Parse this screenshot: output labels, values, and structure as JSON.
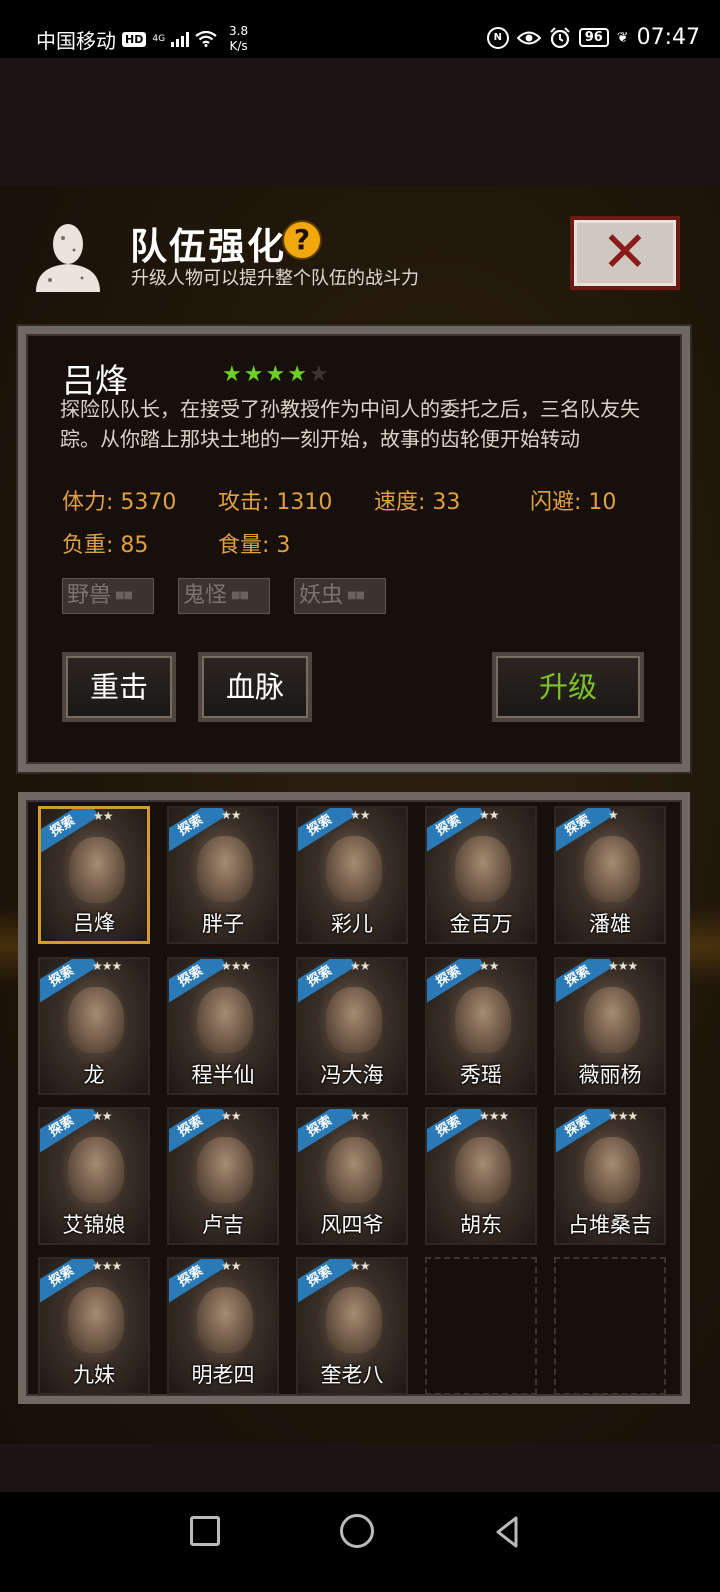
{
  "status_bar": {
    "carrier": "中国移动",
    "hd_badge": "HD",
    "network": "4G",
    "speed_value": "3.8",
    "speed_unit": "K/s",
    "battery": "96",
    "time": "07:47"
  },
  "header": {
    "title": "队伍强化",
    "help_icon": "?",
    "subtitle": "升级人物可以提升整个队伍的战斗力",
    "close_icon": "✕"
  },
  "hero": {
    "name": "吕烽",
    "stars_filled": 4,
    "stars_total": 5,
    "description": "探险队队长，在接受了孙教授作为中间人的委托之后，三名队友失踪。从你踏上那块土地的一刻开始，故事的齿轮便开始转动",
    "stats": {
      "hp": "体力: 5370",
      "attack": "攻击: 1310",
      "speed": "速度: 33",
      "dodge": "闪避: 10",
      "load": "负重: 85",
      "food": "食量: 3"
    },
    "tags": [
      "野兽",
      "鬼怪",
      "妖虫"
    ],
    "buttons": {
      "heavy_strike": "重击",
      "bloodline": "血脉",
      "upgrade": "升级"
    }
  },
  "roster": {
    "ribbon_label": "探索",
    "characters": [
      {
        "name": "吕烽",
        "stars": 2,
        "selected": true
      },
      {
        "name": "胖子",
        "stars": 2
      },
      {
        "name": "彩儿",
        "stars": 2
      },
      {
        "name": "金百万",
        "stars": 2
      },
      {
        "name": "潘雄",
        "stars": 1
      },
      {
        "name": "龙",
        "stars": 3
      },
      {
        "name": "程半仙",
        "stars": 3
      },
      {
        "name": "冯大海",
        "stars": 2
      },
      {
        "name": "秀瑶",
        "stars": 2
      },
      {
        "name": "薇丽杨",
        "stars": 3
      },
      {
        "name": "艾锦娘",
        "stars": 2
      },
      {
        "name": "卢吉",
        "stars": 2
      },
      {
        "name": "风四爷",
        "stars": 2
      },
      {
        "name": "胡东",
        "stars": 3
      },
      {
        "name": "占堆桑吉",
        "stars": 3
      },
      {
        "name": "九妹",
        "stars": 3
      },
      {
        "name": "明老四",
        "stars": 2
      },
      {
        "name": "奎老八",
        "stars": 2
      }
    ],
    "empty_slots": 2
  },
  "colors": {
    "stat": "#e0a040",
    "upgrade": "#7cc12a",
    "star_active": "#6fcf2a",
    "ribbon": "#2a7ab8",
    "selected_border": "#d69a2c"
  }
}
